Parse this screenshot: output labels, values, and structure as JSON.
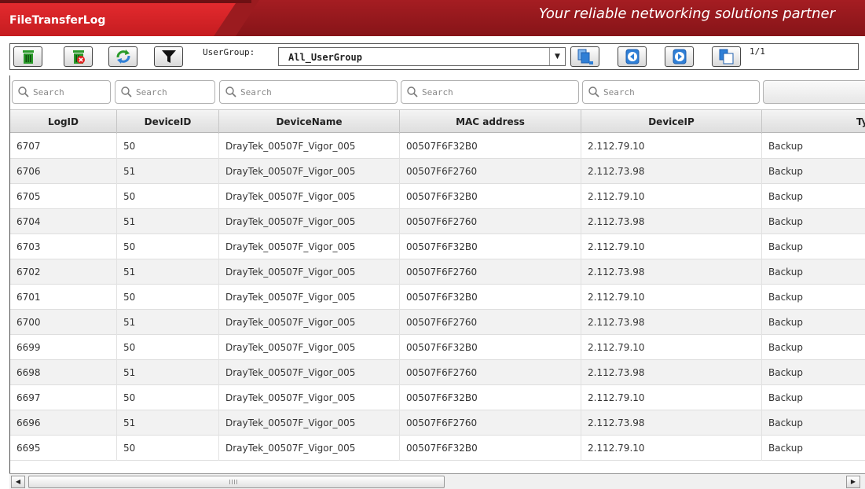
{
  "header": {
    "title": "FileTransferLog",
    "slogan": "Your reliable networking solutions partner"
  },
  "toolbar": {
    "usergroup_label": "UserGroup:",
    "usergroup_value": "All_UserGroup",
    "page_count": "1/1"
  },
  "search": {
    "placeholder": "Search"
  },
  "table": {
    "columns": [
      "LogID",
      "DeviceID",
      "DeviceName",
      "MAC address",
      "DeviceIP",
      "Ty"
    ],
    "rows": [
      [
        "6707",
        "50",
        "DrayTek_00507F_Vigor_005",
        "00507F6F32B0",
        "2.112.79.10",
        "Backup"
      ],
      [
        "6706",
        "51",
        "DrayTek_00507F_Vigor_005",
        "00507F6F2760",
        "2.112.73.98",
        "Backup"
      ],
      [
        "6705",
        "50",
        "DrayTek_00507F_Vigor_005",
        "00507F6F32B0",
        "2.112.79.10",
        "Backup"
      ],
      [
        "6704",
        "51",
        "DrayTek_00507F_Vigor_005",
        "00507F6F2760",
        "2.112.73.98",
        "Backup"
      ],
      [
        "6703",
        "50",
        "DrayTek_00507F_Vigor_005",
        "00507F6F32B0",
        "2.112.79.10",
        "Backup"
      ],
      [
        "6702",
        "51",
        "DrayTek_00507F_Vigor_005",
        "00507F6F2760",
        "2.112.73.98",
        "Backup"
      ],
      [
        "6701",
        "50",
        "DrayTek_00507F_Vigor_005",
        "00507F6F32B0",
        "2.112.79.10",
        "Backup"
      ],
      [
        "6700",
        "51",
        "DrayTek_00507F_Vigor_005",
        "00507F6F2760",
        "2.112.73.98",
        "Backup"
      ],
      [
        "6699",
        "50",
        "DrayTek_00507F_Vigor_005",
        "00507F6F32B0",
        "2.112.79.10",
        "Backup"
      ],
      [
        "6698",
        "51",
        "DrayTek_00507F_Vigor_005",
        "00507F6F2760",
        "2.112.73.98",
        "Backup"
      ],
      [
        "6697",
        "50",
        "DrayTek_00507F_Vigor_005",
        "00507F6F32B0",
        "2.112.79.10",
        "Backup"
      ],
      [
        "6696",
        "51",
        "DrayTek_00507F_Vigor_005",
        "00507F6F2760",
        "2.112.73.98",
        "Backup"
      ],
      [
        "6695",
        "50",
        "DrayTek_00507F_Vigor_005",
        "00507F6F32B0",
        "2.112.79.10",
        "Backup"
      ]
    ]
  },
  "icons": {
    "delete": "trash-green-icon",
    "delete_all": "trash-red-icon",
    "refresh": "refresh-icon",
    "filter": "filter-icon",
    "first": "first-page-icon",
    "prev": "prev-page-icon",
    "next": "next-page-icon",
    "last": "last-page-icon"
  },
  "colors": {
    "brand_red": "#c51c20",
    "header_dark": "#9b1b1f",
    "icon_blue": "#2f7fd6",
    "icon_green": "#2a9a2a"
  }
}
